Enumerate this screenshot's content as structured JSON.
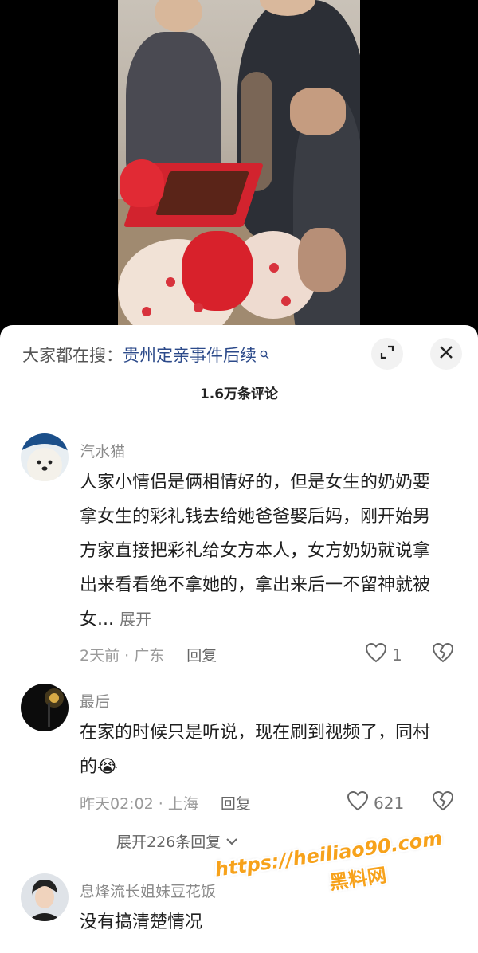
{
  "search_bar": {
    "prefix": "大家都在搜：",
    "term": "贵州定亲事件后续"
  },
  "comment_count": "1.6万条评论",
  "comments": [
    {
      "user": "汽水猫",
      "text": "人家小情侣是俩相情好的，但是女生的奶奶要拿女生的彩礼钱去给她爸爸娶后妈，刚开始男方家直接把彩礼给女方本人，女方奶奶就说拿出来看看绝不拿她的，拿出来后一不留神就被女...",
      "more_label": "展开",
      "time_location": "2天前 · 广东",
      "reply_label": "回复",
      "likes": "1"
    },
    {
      "user": "最后",
      "text": "在家的时候只是听说，现在刷到视频了，同村的😭",
      "time_location": "昨天02:02 · 上海",
      "reply_label": "回复",
      "likes": "621",
      "expand_replies": "展开226条回复"
    },
    {
      "user": "息烽流长姐妹豆花饭",
      "text": "没有搞清楚情况"
    }
  ],
  "watermark": {
    "url": "https://heiliao90.com",
    "name": "黑料网"
  },
  "colors": {
    "search_term": "#2c4a8a",
    "watermark": "#f7a21b"
  }
}
